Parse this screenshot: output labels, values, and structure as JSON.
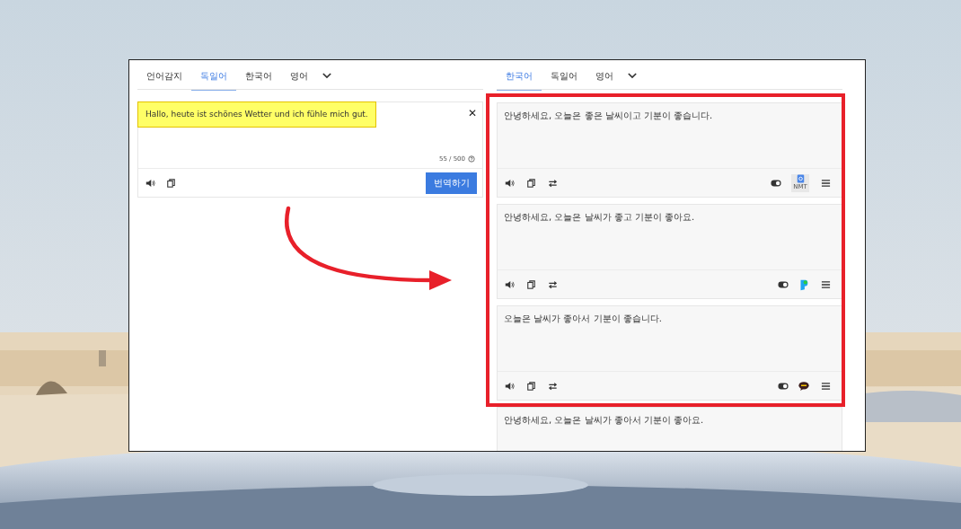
{
  "source": {
    "tabs": [
      {
        "label": "언어감지",
        "selected": false
      },
      {
        "label": "독일어",
        "selected": true
      },
      {
        "label": "한국어",
        "selected": false
      },
      {
        "label": "영어",
        "selected": false
      }
    ],
    "text": "Hallo, heute ist schönes Wetter und ich fühle mich gut.",
    "highlighted": true,
    "close": "✕",
    "counter": "55 / 500",
    "translate_button": "번역하기"
  },
  "target": {
    "tabs": [
      {
        "label": "한국어",
        "selected": true
      },
      {
        "label": "독일어",
        "selected": false
      },
      {
        "label": "영어",
        "selected": false
      }
    ],
    "results": [
      {
        "text": "안녕하세요, 오늘은 좋은 날씨이고 기분이 좋습니다.",
        "kind": "google",
        "toggle_on": true,
        "engine_badge": "NMT"
      },
      {
        "text": "안녕하세요, 오늘은 날씨가 좋고 기분이 좋아요.",
        "kind": "papago",
        "toggle_on": true
      },
      {
        "text": "오늘은 날씨가 좋아서 기분이 좋습니다.",
        "kind": "kakao",
        "toggle_on": true
      },
      {
        "text": "안녕하세요, 오늘은 날씨가 좋아서 기분이 좋아요."
      }
    ]
  }
}
